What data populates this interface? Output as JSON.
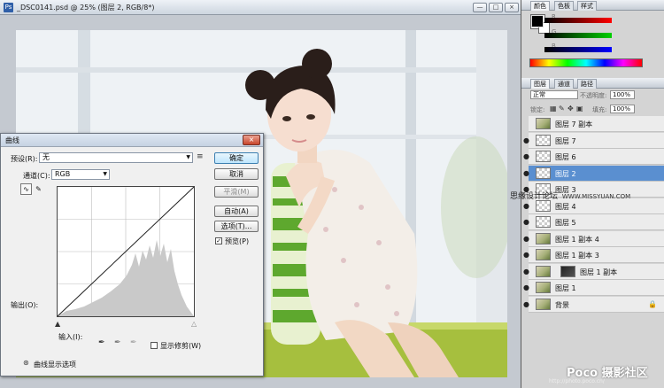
{
  "document": {
    "title": "_DSC0141.psd @ 25% (图层 2, RGB/8*)",
    "window_buttons": [
      "—",
      "□",
      "×"
    ]
  },
  "curves_dialog": {
    "title": "曲线",
    "close": "×",
    "preset_label": "预设(R):",
    "preset_value": "无",
    "channel_label": "通道(C):",
    "channel_value": "RGB",
    "output_label": "输出(O):",
    "input_label": "输入(I):",
    "buttons": {
      "ok": "确定",
      "cancel": "取消",
      "smooth": "平滑(M)",
      "auto": "自动(A)",
      "options": "选项(T)..."
    },
    "preview_label": "预览(P)",
    "show_clipping_label": "显示修剪(W)",
    "curve_display_options": "曲线显示选项",
    "colors": {
      "histogram": "#c9c9c9",
      "curve": "#222222"
    }
  },
  "color_panel": {
    "tabs": [
      "颜色",
      "色板",
      "样式"
    ],
    "channels": [
      "R",
      "G",
      "B"
    ]
  },
  "layers_panel": {
    "tabs": [
      "图层",
      "通道",
      "路径"
    ],
    "blend_mode": "正常",
    "opacity_label": "不透明度:",
    "opacity_value": "100%",
    "lock_label": "锁定:",
    "fill_label": "填充:",
    "fill_value": "100%",
    "layers": [
      {
        "name": "图层 7 副本",
        "visible": false,
        "thumb": "img",
        "selected": false
      },
      {
        "name": "图层 7",
        "visible": true,
        "thumb": "check",
        "selected": false
      },
      {
        "name": "图层 6",
        "visible": true,
        "thumb": "check",
        "selected": false
      },
      {
        "name": "图层 2",
        "visible": true,
        "thumb": "check",
        "selected": true
      },
      {
        "name": "图层 3",
        "visible": true,
        "thumb": "check",
        "selected": false
      },
      {
        "name": "图层 4",
        "visible": true,
        "thumb": "check",
        "selected": false
      },
      {
        "name": "图层 5",
        "visible": true,
        "thumb": "check",
        "selected": false
      },
      {
        "name": "图层 1 副本 4",
        "visible": true,
        "thumb": "img",
        "selected": false
      },
      {
        "name": "图层 1 副本 3",
        "visible": true,
        "thumb": "img",
        "selected": false
      },
      {
        "name": "图层 1 副本",
        "visible": true,
        "thumb": "img",
        "selected": false
      },
      {
        "name": "图层 1",
        "visible": true,
        "thumb": "img",
        "selected": false
      },
      {
        "name": "背景",
        "visible": true,
        "thumb": "img",
        "selected": false
      }
    ]
  },
  "watermarks": {
    "site_cn": "思缘设计论坛",
    "site_url": "WWW.MISSYUAN.COM",
    "poco": "Poco 摄影社区",
    "poco_url": "http://photo.poco.cn/"
  }
}
